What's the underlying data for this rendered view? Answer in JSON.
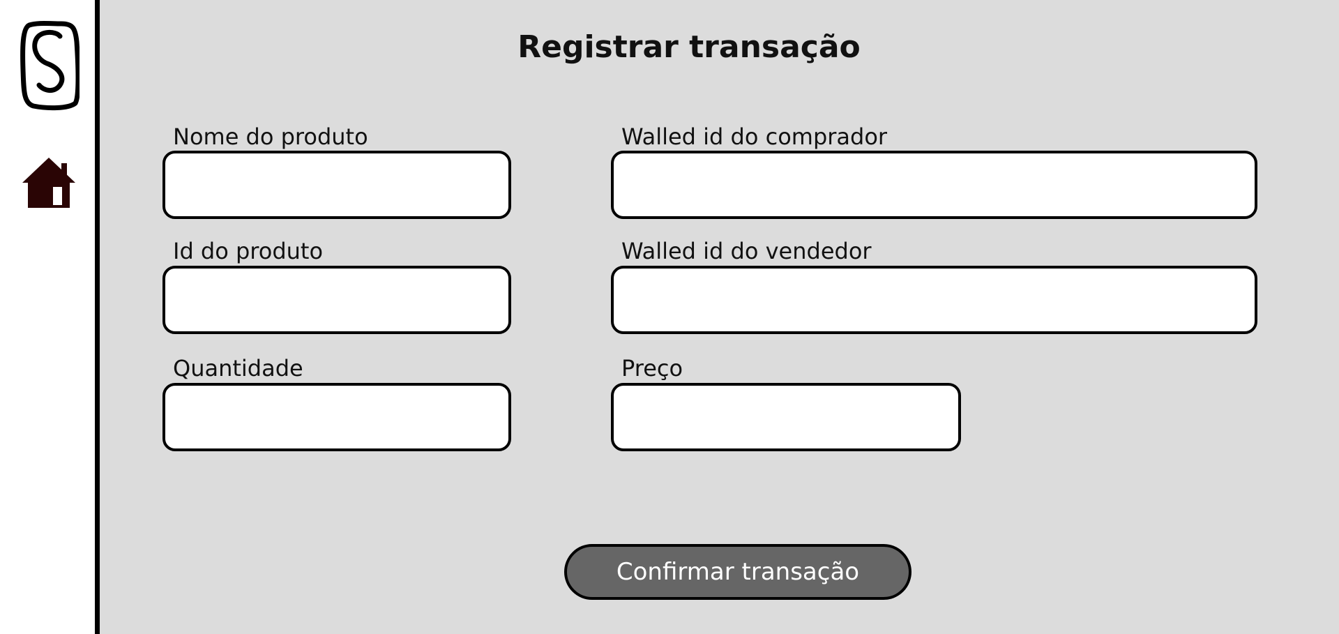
{
  "sidebar": {
    "logo_icon": "hand-drawn-s-logo",
    "home_icon": "home-icon",
    "home_color": "#2a0505"
  },
  "page": {
    "title": "Registrar transação"
  },
  "form": {
    "product_name": {
      "label": "Nome do produto",
      "value": "",
      "placeholder": ""
    },
    "product_id": {
      "label": "Id do produto",
      "value": "",
      "placeholder": ""
    },
    "quantity": {
      "label": "Quantidade",
      "value": "",
      "placeholder": ""
    },
    "buyer_wallet": {
      "label": "Walled id do comprador",
      "value": "",
      "placeholder": ""
    },
    "seller_wallet": {
      "label": "Walled id do vendedor",
      "value": "",
      "placeholder": ""
    },
    "price": {
      "label": "Preço",
      "value": "",
      "placeholder": ""
    }
  },
  "actions": {
    "confirm_label": "Confirmar transação"
  },
  "colors": {
    "background": "#dcdcdc",
    "sidebar": "#ffffff",
    "button": "#666666",
    "border": "#000000"
  }
}
